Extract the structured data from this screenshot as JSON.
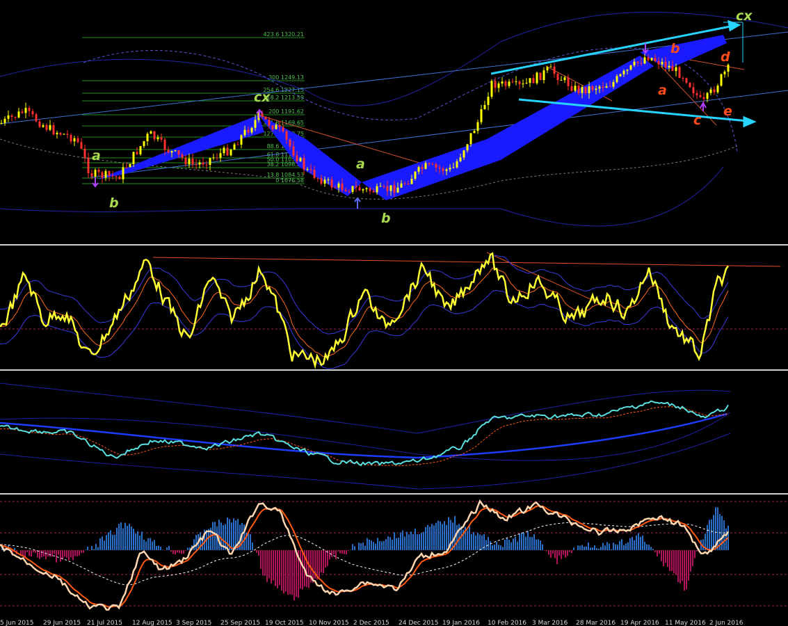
{
  "colors": {
    "background": "#000000",
    "bull_candle": "#ffff00",
    "bear_candle": "#ff3030",
    "pattern_fill": "#1a1aff",
    "channel_lines": "#27d4ff",
    "fib_lines": "#1f8f1f",
    "bands": "#2a2acc",
    "osc_line": "#ffff33",
    "osc_signal": "#ff6a1a",
    "histogram_pos": "#2a6fc8",
    "histogram_neg": "#b0145a",
    "stoch_main": "#ffd0a0"
  },
  "fib_labels": [
    "423.6 1320.21",
    "300 1249.13",
    "254.6 1227.15",
    "218.2 1213.59",
    "200 1191.62",
    "161.8 1169.65",
    "127.2 1149.75",
    "88.6 1127.37",
    "61.8 1111.85",
    "50.0 1105.04",
    "38.2 1098.22",
    "13.8 1084.53",
    "0 1076.58"
  ],
  "wave_labels": {
    "left_a": "a",
    "left_b": "b",
    "left_cx": "cx",
    "mid_a": "a",
    "mid_b": "b",
    "right_cx": "cx",
    "right_b": "b",
    "right_d": "d",
    "right_a": "a",
    "right_c": "c",
    "right_e": "e"
  },
  "time_axis": [
    "5 Jun 2015",
    "29 Jun 2015",
    "21 Jul 2015",
    "12 Aug 2015",
    "3 Sep 2015",
    "25 Sep 2015",
    "19 Oct 2015",
    "10 Nov 2015",
    "2 Dec 2015",
    "24 Dec 2015",
    "19 Jan 2016",
    "10 Feb 2016",
    "3 Mar 2016",
    "28 Mar 2016",
    "19 Apr 2016",
    "11 May 2016",
    "2 Jun 2016"
  ]
}
